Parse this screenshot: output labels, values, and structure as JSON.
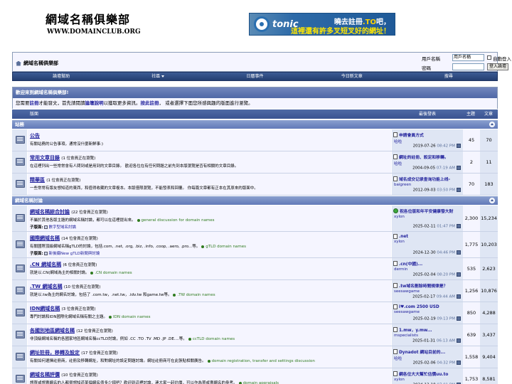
{
  "header": {
    "site_title": "網域名稱俱樂部",
    "site_url": "WWW.DOMAINCLUB.ORG",
    "banner": {
      "brand": "tonic",
      "line1_pre": "曉去註冊",
      "line1_hl": ".TO",
      "line1_post": "吧，",
      "line2": "這裡還有許多叉短叉好的網址！"
    }
  },
  "navbar": {
    "breadcrumb": "網域名稱俱樂部",
    "login": {
      "username_label": "用戶名稱",
      "username_value": "用戶名稱",
      "remember_label": "自動登入",
      "password_label": "密碼",
      "login_button": "登入論壇"
    }
  },
  "menu": [
    {
      "label": "論壇幫助"
    },
    {
      "label": "社區"
    },
    {
      "label": "日曆事件"
    },
    {
      "label": "今日新文章"
    },
    {
      "label": "搜尋"
    }
  ],
  "welcome": {
    "title": "歡迎來到網域名稱俱樂部!",
    "text_1": "您需要",
    "link_register": "註冊",
    "text_2": "才能發文，首先請閱讀",
    "link_faq": "論壇說明",
    "text_3": "以獲取更多資訊。",
    "link_reg2": "按此註冊",
    "text_4": "， 或者選擇下面您所感興趣的版面進行瀏覽。"
  },
  "columns": {
    "forum": "版面",
    "last_post": "最後發表",
    "threads": "主題",
    "posts": "文章"
  },
  "categories": [
    {
      "title": "站務",
      "forums": [
        {
          "name": "公告",
          "viewing": "",
          "desc": "有關站務的公告事項，通常沒什麼新鮮事:)",
          "desc_en": "",
          "sub_label": "",
          "sub_link": "",
          "lp_title": "申請會員方式",
          "lp_user": "哈啦",
          "lp_date": "2019-07-26",
          "lp_time": "08:42 PM",
          "threads": "45",
          "posts": "70",
          "lp_icon": "doc"
        },
        {
          "name": "常用文章目錄",
          "viewing": "(1 位會員正在瀏覽)",
          "desc": "在這裡列出一些常常會有人問到或是用到的文章目錄。 歡迎各位在有任何問題之前先到本版瀏覽是否有相關的文章目錄。",
          "desc_en": "",
          "sub_label": "",
          "sub_link": "",
          "lp_title": "網址的註冊、設定和移轉。",
          "lp_user": "哈啦",
          "lp_date": "2004-09-05",
          "lp_time": "07:19 AM",
          "threads": "2",
          "posts": "11",
          "lp_icon": "doc"
        },
        {
          "name": "精華區",
          "viewing": "(1 位會員正在瀏覽)",
          "desc": "一些常常有版友想知道的東西，和值得收藏的文章複本。本版僅限瀏覽，不能發表和回覆。 你每篇文章都有正本在其原來的版面中。",
          "desc_en": "",
          "sub_label": "",
          "sub_link": "",
          "lp_title": "域名成交记录查询功能上线-",
          "lp_user": "baigreen",
          "lp_date": "2012-09-03",
          "lp_time": "03:50 PM",
          "threads": "70",
          "posts": "183",
          "lp_icon": "doc"
        }
      ]
    },
    {
      "title": "網域名稱討論",
      "forums": [
        {
          "name": "網域名稱綜合討論",
          "viewing": "(22 位會員正在瀏覽)",
          "desc": "不屬於其他各版主題的網域名稱討論，都可以在這裡提出來。",
          "desc_en": "general discussion for domain names",
          "sub_label": "子版面:",
          "sub_link": "數字型域名討論",
          "lp_title": "祝各位版和年平安健康發大財",
          "lp_user": "xylon",
          "lp_date": "2025-02-11",
          "lp_time": "01:47 PM",
          "threads": "2,300",
          "posts": "15,234",
          "lp_icon": "smile"
        },
        {
          "name": "國際網域名稱",
          "viewing": "(14 位會員正在瀏覽)",
          "desc": "有關國際頂級網域名稱gTLD的討論，包括.com, .net, .org, .biz, .info, .coop, .aero, .pro...等。",
          "desc_en": "gTLD domain names",
          "sub_label": "子版面:",
          "sub_link": "新後綴New gTLD新聞與討論",
          "lp_title": ".net",
          "lp_user": "xylon",
          "lp_date": "2024-12-30",
          "lp_time": "04:46 PM",
          "threads": "1,775",
          "posts": "10,203",
          "lp_icon": "doc"
        },
        {
          "name": ".CN 網域名稱",
          "viewing": "(6 位會員正在瀏覽)",
          "desc": "就是以.CN(網域為主的相關討論。",
          "desc_en": ".CN domain names",
          "sub_label": "",
          "sub_link": "",
          "lp_title": ".cn(中國)...",
          "lp_user": "dermin",
          "lp_date": "2025-02-04",
          "lp_time": "08:20 PM",
          "threads": "535",
          "posts": "2,623",
          "lp_icon": "doc"
        },
        {
          "name": ".TW 網域名稱",
          "viewing": "(10 位會員正在瀏覽)",
          "desc": "就是以.tw為主的網名討論，包括了 .com.tw，.net.tw，.idv.tw 和game.tw等。",
          "desc_en": ".TW domain names",
          "sub_label": "",
          "sub_link": "",
          "lp_title": ".tw域名刪除時間規律是？",
          "lp_user": "seesawgame",
          "lp_date": "2025-02-17",
          "lp_time": "09:44 AM",
          "threads": "1,256",
          "posts": "10,876",
          "lp_icon": "doc"
        },
        {
          "name": "IDN網域名稱",
          "viewing": "(3 位會員正在瀏覽)",
          "desc": "專門討論和IDN國際化網域名稱有關之主題。",
          "desc_en": "IDN domain names",
          "sub_label": "",
          "sub_link": "",
          "lp_title": "i♥.com 2500 USD",
          "lp_user": "seesawgame",
          "lp_date": "2025-02-19",
          "lp_time": "09:13 PM",
          "threads": "850",
          "posts": "4,288",
          "lp_icon": "doc"
        },
        {
          "name": "各國別地區網域名稱",
          "viewing": "(12 位會員正在瀏覽)",
          "desc": "非頂級網域名稱的各國家地區網域名稱ccTLD討論，例如 .CC .TO .TV .MD .JP .DE....等。",
          "desc_en": "ccTLD domain names",
          "sub_label": "",
          "sub_link": "",
          "lp_title": "1.mw，y.mw...",
          "lp_user": "mspecialists",
          "lp_date": "2025-01-31",
          "lp_time": "06:13 AM",
          "threads": "639",
          "posts": "3,437",
          "lp_icon": "doc"
        },
        {
          "name": "網址註冊，移轉及設定",
          "viewing": "(17 位會員正在瀏覽)",
          "desc": "有關如何選擇註冊商，註冊及移轉網址，和對網址的設定問題討論。網址註冊商可在此張貼相關廣告。",
          "desc_en": "domain registration, transfer and settings discussion",
          "sub_label": "",
          "sub_link": "",
          "lp_title": "Dynadot 網站目前的...",
          "lp_user": "哈啦",
          "lp_date": "2025-02-06",
          "lp_time": "04:32 PM",
          "threads": "1,558",
          "posts": "9,404",
          "lp_icon": "doc"
        },
        {
          "name": "網域名稱評價",
          "viewing": "(10 位會員正在瀏覽)",
          "desc": "想買或想賣網名的人都很想知道某個網名值多少錢吧？歡迎到這裡討論，連大家一起估價，可以作為買或賣網名的參考。",
          "desc_en": "domain appraisals",
          "sub_label": "",
          "sub_link": "",
          "lp_title": "網各位大大幫忙估價uu.to",
          "lp_user": "xylon",
          "lp_date": "2024-12-18",
          "lp_time": "07:01 PM",
          "threads": "1,753",
          "posts": "8,581",
          "lp_icon": "doc"
        }
      ]
    }
  ]
}
